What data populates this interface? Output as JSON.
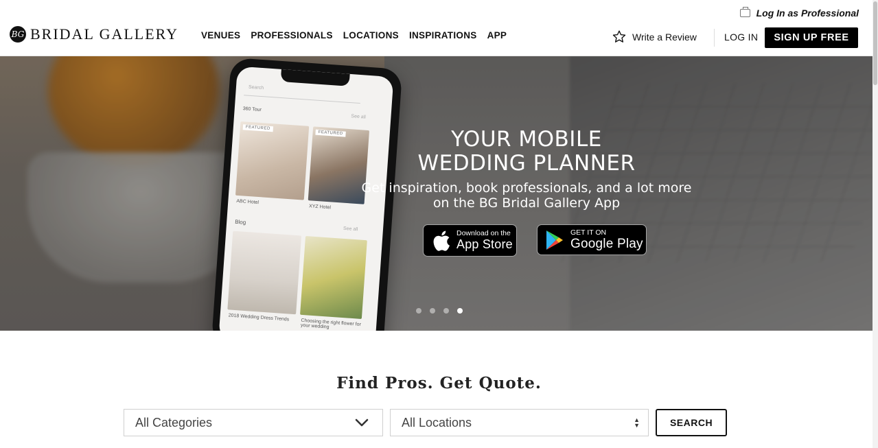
{
  "header": {
    "logo_text": "BRIDAL GALLERY",
    "logo_badge": "BG",
    "nav": [
      "VENUES",
      "PROFESSIONALS",
      "LOCATIONS",
      "INSPIRATIONS",
      "APP"
    ],
    "pro_login": "Log In as Professional",
    "write_review": "Write a Review",
    "login": "LOG IN",
    "signup": "SIGN UP FREE"
  },
  "hero": {
    "title_line1": "YOUR MOBILE",
    "title_line2": "WEDDING PLANNER",
    "subtitle_line1": "Get inspiration, book professionals, and a lot more",
    "subtitle_line2": "on the BG Bridal Gallery App",
    "app_store": {
      "small": "Download on the",
      "big": "App Store"
    },
    "google_play": {
      "small": "GET IT ON",
      "big": "Google Play"
    },
    "slides_count": 4,
    "active_slide": 4,
    "phone": {
      "search_placeholder": "Search",
      "section1": "360 Tour",
      "see_all": "See all",
      "featured": "FEATURED",
      "card1": "ABC Hotel",
      "card2": "XYZ Hotel",
      "section2": "Blog",
      "blog1": "2018 Wedding Dress Trends",
      "blog2": "Choosing the right flower for your wedding"
    }
  },
  "search": {
    "title": "Find Pros. Get Quote.",
    "category": "All Categories",
    "location": "All Locations",
    "button": "SEARCH"
  },
  "colors": {
    "brand_black": "#000000",
    "text": "#111111",
    "border": "#cfcfcf"
  }
}
